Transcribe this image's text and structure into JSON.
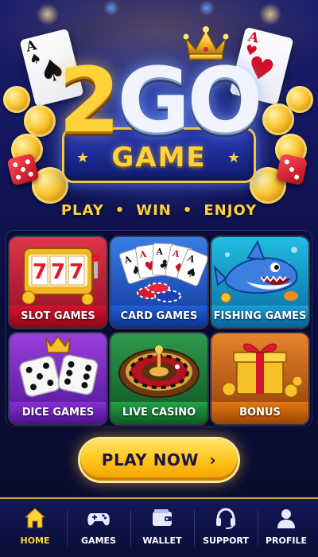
{
  "app": {
    "logo_number": "2",
    "logo_word": "GO",
    "logo_sub": "GAME",
    "tagline": [
      "PLAY",
      "WIN",
      "ENJOY"
    ],
    "tagline_separator": "•"
  },
  "games": [
    {
      "label": "SLOT GAMES",
      "icon": "slot-machine-icon",
      "color": "#d4132c"
    },
    {
      "label": "CARD GAMES",
      "icon": "playing-cards-icon",
      "color": "#1f5fd6"
    },
    {
      "label": "FISHING GAMES",
      "icon": "shark-icon",
      "color": "#1aa0d9"
    },
    {
      "label": "DICE GAMES",
      "icon": "dice-icon",
      "color": "#8a2fd6"
    },
    {
      "label": "LIVE CASINO",
      "icon": "roulette-icon",
      "color": "#22a444"
    },
    {
      "label": "BONUS",
      "icon": "gift-box-icon",
      "color": "#e37914"
    }
  ],
  "slot_reels": [
    "7",
    "7",
    "7"
  ],
  "play_button": {
    "label": "PLAY NOW",
    "icon": "chevron-right-icon"
  },
  "nav": {
    "active": "HOME",
    "items": [
      {
        "label": "HOME",
        "icon": "home-icon"
      },
      {
        "label": "GAMES",
        "icon": "gamepad-icon"
      },
      {
        "label": "WALLET",
        "icon": "wallet-icon"
      },
      {
        "label": "SUPPORT",
        "icon": "headset-icon"
      },
      {
        "label": "PROFILE",
        "icon": "user-icon"
      }
    ]
  },
  "colors": {
    "gold": "#ffd23a",
    "navy": "#0a0f3a",
    "nav_border": "#c9a43a"
  }
}
